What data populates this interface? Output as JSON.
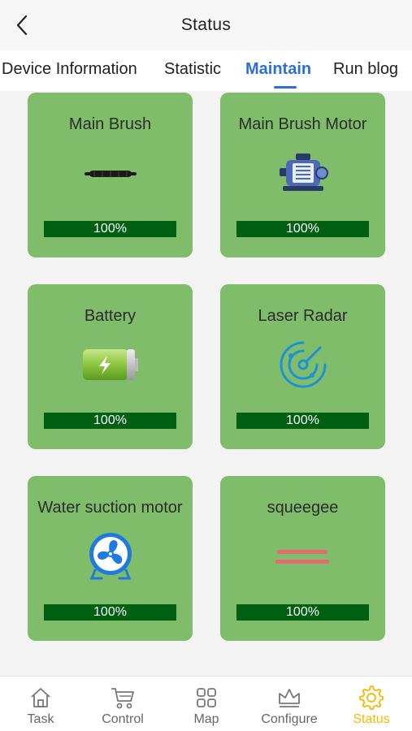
{
  "header": {
    "title": "Status"
  },
  "tabs": [
    {
      "label": "Device Information"
    },
    {
      "label": "Statistic"
    },
    {
      "label": "Maintain"
    },
    {
      "label": "Run blog"
    }
  ],
  "active_tab": "Maintain",
  "cards": [
    {
      "label": "Main Brush",
      "icon": "brush-icon",
      "progress_text": "100%",
      "progress": 1.0
    },
    {
      "label": "Main Brush Motor",
      "icon": "motor-icon",
      "progress_text": "100%",
      "progress": 1.0
    },
    {
      "label": "Battery",
      "icon": "battery-icon",
      "progress_text": "100%",
      "progress": 1.0
    },
    {
      "label": "Laser Radar",
      "icon": "radar-icon",
      "progress_text": "100%",
      "progress": 1.0
    },
    {
      "label": "Water suction motor",
      "icon": "fan-icon",
      "progress_text": "100%",
      "progress": 1.0
    },
    {
      "label": "squeegee",
      "icon": "squeegee-icon",
      "progress_text": "100%",
      "progress": 1.0
    }
  ],
  "bottom_nav": [
    {
      "label": "Task",
      "icon": "home-icon"
    },
    {
      "label": "Control",
      "icon": "cart-icon"
    },
    {
      "label": "Map",
      "icon": "grid-icon"
    },
    {
      "label": "Configure",
      "icon": "crown-icon"
    },
    {
      "label": "Status",
      "icon": "gear-icon",
      "active": true
    }
  ],
  "colors": {
    "accent": "#2a6fdb",
    "card_bg": "#80bd6b",
    "progress_bar": "#005f10",
    "active_nav": "#f5b800"
  }
}
